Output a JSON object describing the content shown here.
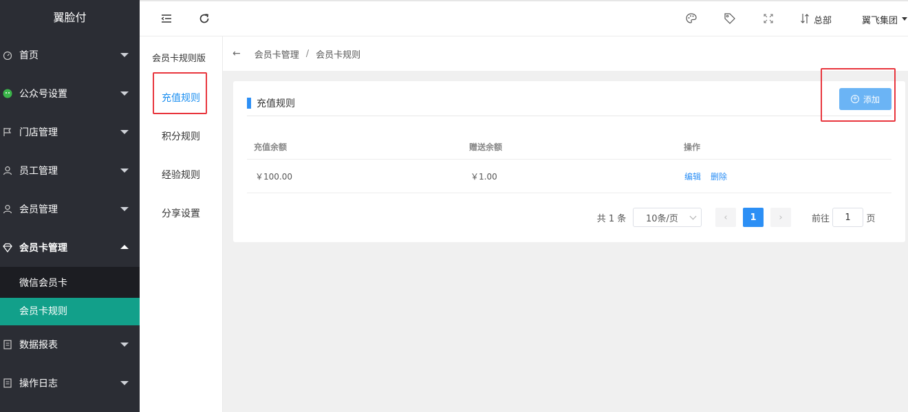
{
  "app": {
    "brand": "翼脸付"
  },
  "sidebar": {
    "items": [
      {
        "label": "首页",
        "icon": "dashboard-icon"
      },
      {
        "label": "公众号设置",
        "icon": "wechat-icon"
      },
      {
        "label": "门店管理",
        "icon": "flag-icon"
      },
      {
        "label": "员工管理",
        "icon": "user-icon"
      },
      {
        "label": "会员管理",
        "icon": "user-icon"
      },
      {
        "label": "会员卡管理",
        "icon": "diamond-icon"
      },
      {
        "label": "数据报表",
        "icon": "report-icon"
      },
      {
        "label": "操作日志",
        "icon": "log-icon"
      }
    ],
    "submenu": [
      {
        "label": "微信会员卡"
      },
      {
        "label": "会员卡规则"
      }
    ]
  },
  "topbar": {
    "hq_label": "总部",
    "org_label": "翼飞集团"
  },
  "subnav": {
    "title": "会员卡规则版",
    "items": [
      {
        "label": "充值规则"
      },
      {
        "label": "积分规则"
      },
      {
        "label": "经验规则"
      },
      {
        "label": "分享设置"
      }
    ]
  },
  "breadcrumb": {
    "back": "←",
    "parent": "会员卡管理",
    "separator": "/",
    "current": "会员卡规则"
  },
  "card": {
    "title": "充值规则",
    "add_label": "添加",
    "columns": [
      "充值余额",
      "赠送余额",
      "操作"
    ],
    "rows": [
      {
        "recharge": "￥100.00",
        "bonus": "￥1.00",
        "edit": "编辑",
        "delete": "删除"
      }
    ]
  },
  "pagination": {
    "total_text": "共 1 条",
    "page_size": "10条/页",
    "prev": "‹",
    "current_page": "1",
    "next": "›",
    "goto_prefix": "前往",
    "goto_value": "1",
    "goto_suffix": "页"
  },
  "colors": {
    "sidebar_bg": "#2b2d34",
    "active_sub": "#12a08a",
    "accent": "#2c8ff5",
    "annotation": "#e8343c"
  }
}
